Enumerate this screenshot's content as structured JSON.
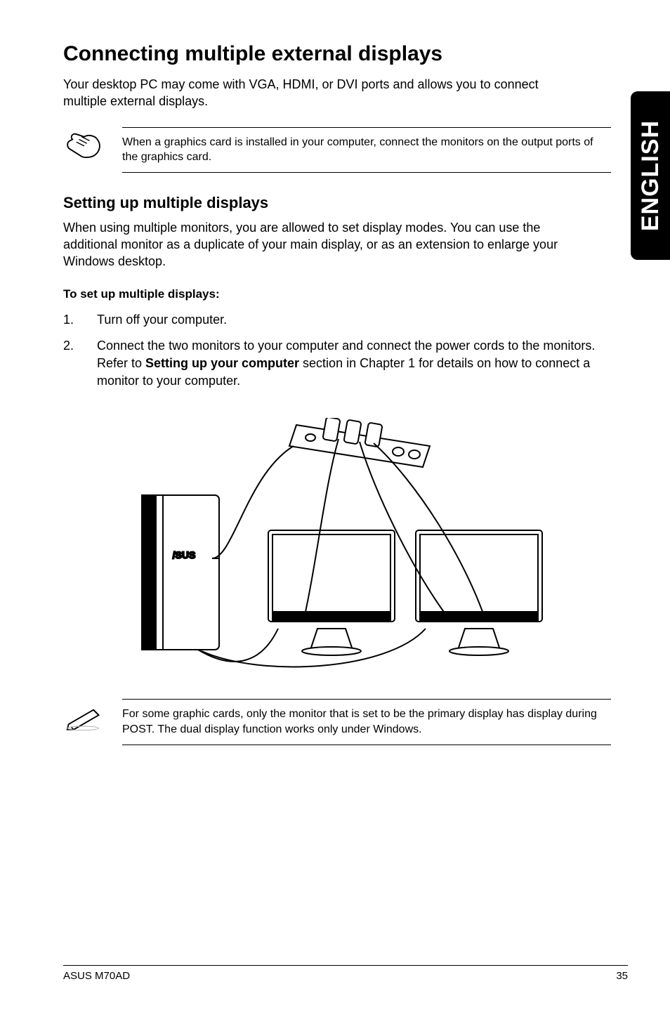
{
  "side_tab": "ENGLISH",
  "title": "Connecting multiple external displays",
  "intro": "Your desktop PC may come with VGA, HDMI, or DVI ports and allows you to connect multiple external displays.",
  "note1_icon": "hand-pointing-icon",
  "note1": "When a graphics card is installed in your computer, connect the monitors on the output ports of the graphics card.",
  "subhead": "Setting up multiple displays",
  "subintro": "When using multiple monitors, you are allowed to set display modes. You can use the additional monitor as a duplicate of your main display, or as an extension to enlarge your Windows desktop.",
  "steps_heading": "To set up multiple displays:",
  "steps": [
    {
      "num": "1.",
      "text": "Turn off your computer."
    },
    {
      "num": "2.",
      "prefix": "Connect the two monitors to your computer and connect the power cords to the monitors. Refer to ",
      "bold": "Setting up your computer",
      "suffix": " section in Chapter 1 for details on how to connect a monitor to your computer."
    }
  ],
  "note2_icon": "pencil-note-icon",
  "note2": "For some graphic cards, only the monitor that is set to be the primary display has display during POST. The dual display function works only under Windows.",
  "footer_left": "ASUS M70AD",
  "footer_right": "35"
}
